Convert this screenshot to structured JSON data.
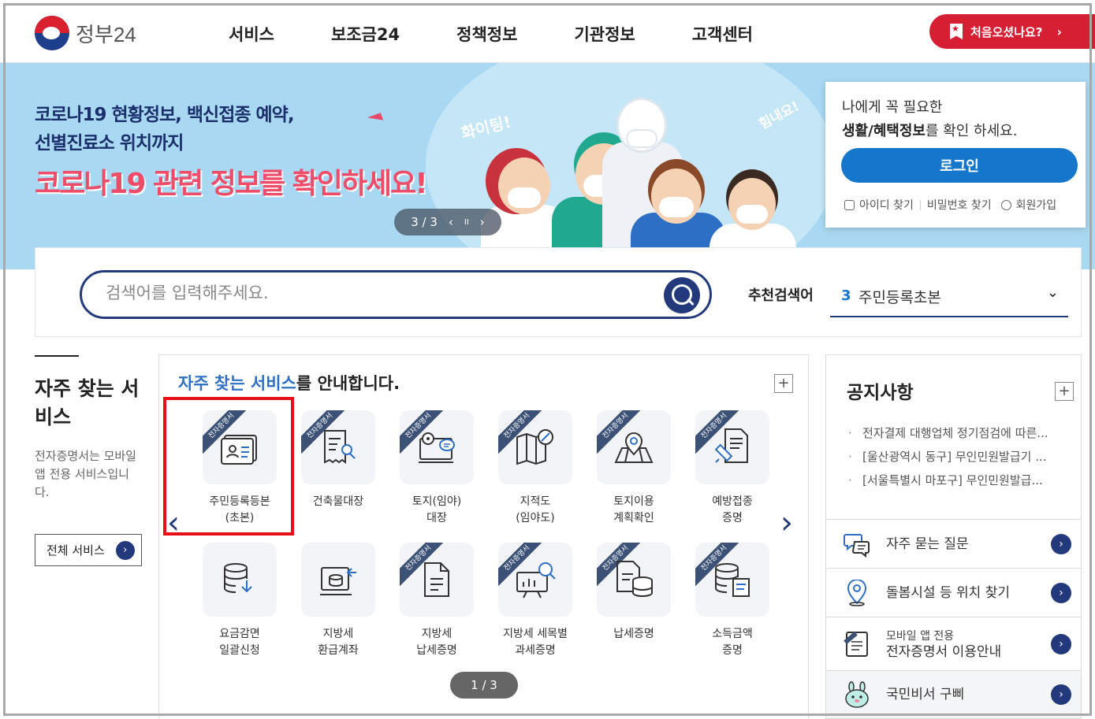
{
  "header": {
    "logo_text": "정부24",
    "nav": [
      "서비스",
      "보조금24",
      "정책정보",
      "기관정보",
      "고객센터"
    ],
    "first_visit_label": "처음오셨나요?",
    "first_visit_chevron": "›"
  },
  "banner": {
    "line1": "코로나19 현황정보, 백신접종 예약,",
    "line2": "선별진료소 위치까지",
    "line3": "코로나19 관련 정보를 확인하세요!",
    "deco_left": "화이팅!",
    "deco_right": "힘내요!",
    "pager": {
      "current": "3 / 3",
      "prev": "‹",
      "pause": "II",
      "next": "›"
    }
  },
  "login_card": {
    "line1": "나에게 꼭 필요한",
    "line2_bold": "생활/혜택정보",
    "line2_rest": "를 확인 하세요.",
    "login_button": "로그인",
    "find_id": "아이디 찾기",
    "find_pw": "비밀번호 찾기",
    "signup": "회원가입"
  },
  "search": {
    "placeholder": "검색어를 입력해주세요.",
    "recommend_label": "추천검색어",
    "recommend_num": "3",
    "recommend_text": "주민등록초본",
    "recommend_chevron": "⌄"
  },
  "sidebar": {
    "title": "자주 찾는 서비스",
    "description": "전자증명서는 모바일 앱 전용 서비스입니다.",
    "all_services": "전체 서비스",
    "arrow": "›"
  },
  "services": {
    "heading_highlight": "자주 찾는 서비스",
    "heading_rest": "를 안내합니다.",
    "plus": "+",
    "ribbon": "전자증명서",
    "prev": "‹",
    "next": "›",
    "pager": "1 / 3",
    "row1": [
      {
        "l1": "주민등록등본",
        "l2": "(초본)",
        "icon": "id-card-icon"
      },
      {
        "l1": "건축물대장",
        "l2": "",
        "icon": "document-search-icon"
      },
      {
        "l1": "토지(임야)",
        "l2": "대장",
        "icon": "land-map-icon"
      },
      {
        "l1": "지적도",
        "l2": "(임야도)",
        "icon": "folded-map-icon"
      },
      {
        "l1": "토지이용",
        "l2": "계획확인",
        "icon": "location-map-icon"
      },
      {
        "l1": "예방접종",
        "l2": "증명",
        "icon": "syringe-icon"
      }
    ],
    "row2": [
      {
        "l1": "요금감면",
        "l2": "일괄신청",
        "icon": "database-download-icon"
      },
      {
        "l1": "지방세",
        "l2": "환급계좌",
        "icon": "account-refund-icon"
      },
      {
        "l1": "지방세",
        "l2": "납세증명",
        "icon": "document-icon"
      },
      {
        "l1": "지방세 세목별",
        "l2": "과세증명",
        "icon": "chart-search-icon"
      },
      {
        "l1": "납세증명",
        "l2": "",
        "icon": "document-database-icon"
      },
      {
        "l1": "소득금액",
        "l2": "증명",
        "icon": "database-document-icon"
      }
    ]
  },
  "notice": {
    "title": "공지사항",
    "plus": "+",
    "items": [
      "전자결제 대행업체 정기점검에 따른...",
      "[울산광역시 동구] 무인민원발급기 ...",
      "[서울특별시 마포구] 무인민원발급..."
    ]
  },
  "quick_links": [
    {
      "label": "자주 묻는 질문",
      "small": "",
      "icon": "chat-icon",
      "arrow": "›"
    },
    {
      "label": "돌봄시설 등 위치 찾기",
      "small": "",
      "icon": "location-pin-icon",
      "arrow": "›"
    },
    {
      "label": "전자증명서 이용안내",
      "small": "모바일 앱 전용",
      "icon": "mobile-certificate-icon",
      "arrow": "›"
    },
    {
      "label": "국민비서 구삐",
      "small": "",
      "icon": "mascot-icon",
      "arrow": "›"
    }
  ],
  "colors": {
    "brand_navy": "#223a7c",
    "accent_red": "#d71f34",
    "login_blue": "#1577cc",
    "highlight_red": "#e51017",
    "banner_bg": "#a9d9f2"
  }
}
